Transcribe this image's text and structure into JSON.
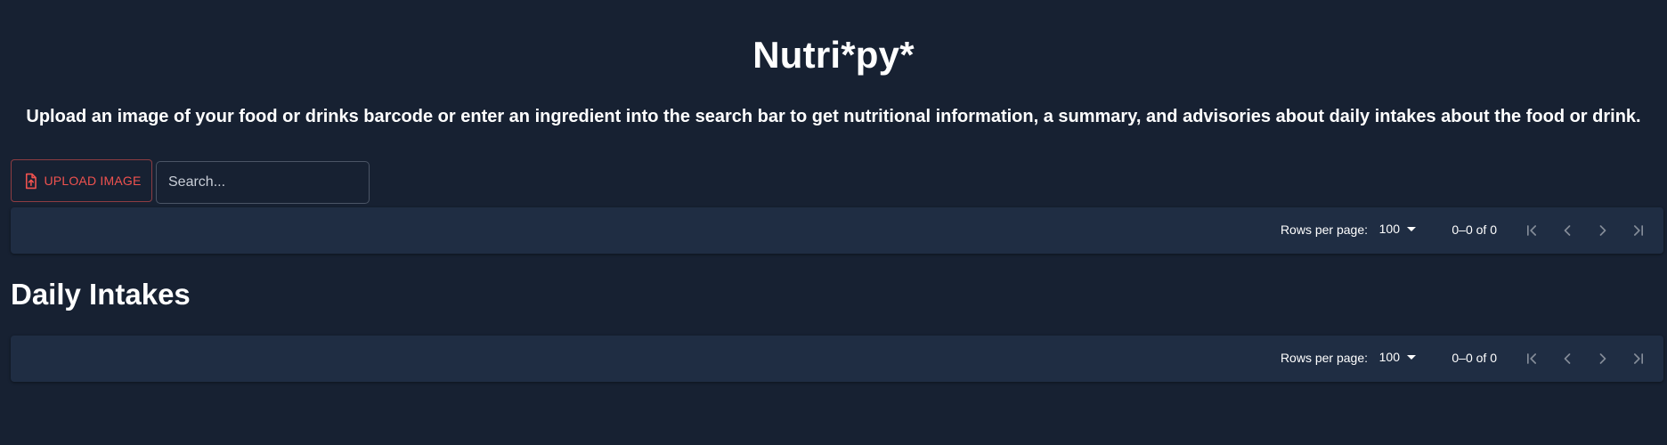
{
  "app": {
    "title": "Nutri*py*",
    "subtitle": "Upload an image of your food or drinks barcode or enter an ingredient into the search bar to get nutritional information, a summary, and advisories about daily intakes about the food or drink."
  },
  "actions": {
    "upload_label": "UPLOAD IMAGE",
    "upload_icon": "file-upload-icon",
    "search_placeholder": "Search..."
  },
  "results_table": {
    "pagination": {
      "rows_per_page_label": "Rows per page:",
      "rows_per_page_value": "100",
      "range_text": "0–0 of 0",
      "icons": [
        "first-page-icon",
        "previous-page-icon",
        "next-page-icon",
        "last-page-icon"
      ]
    }
  },
  "daily_intakes": {
    "heading": "Daily Intakes",
    "pagination": {
      "rows_per_page_label": "Rows per page:",
      "rows_per_page_value": "100",
      "range_text": "0–0 of 0",
      "icons": [
        "first-page-icon",
        "previous-page-icon",
        "next-page-icon",
        "last-page-icon"
      ]
    }
  },
  "theme": {
    "background": "#172132",
    "panel": "#1f2d43",
    "accent": "#f0524f",
    "text": "#ffffff"
  }
}
